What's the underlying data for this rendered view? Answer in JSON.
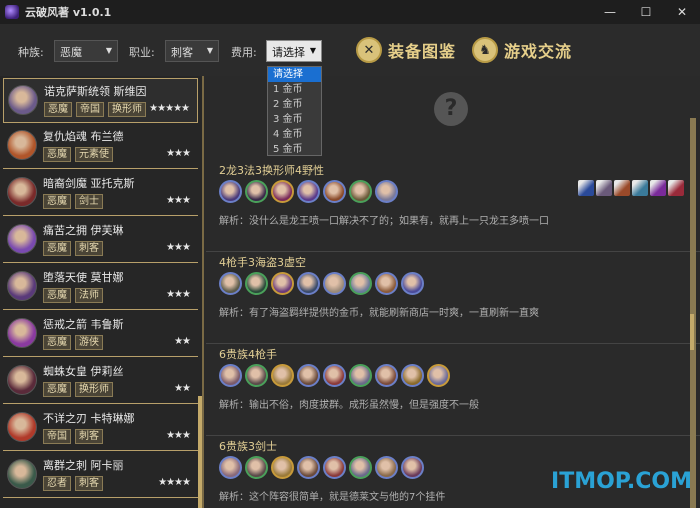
{
  "window": {
    "title": "云破风著 v1.0.1",
    "controls": {
      "minimize": "—",
      "maximize": "☐",
      "close": "✕"
    }
  },
  "toolbar": {
    "race_label": "种族:",
    "race_value": "恶魔",
    "class_label": "职业:",
    "class_value": "刺客",
    "cost_label": "费用:",
    "cost_value": "请选择",
    "equip_button": "装备图鉴",
    "community_button": "游戏交流"
  },
  "cost_dropdown": {
    "options": [
      "请选择",
      "1 金币",
      "2 金币",
      "3 金币",
      "4 金币",
      "5 金币"
    ],
    "selected": 0
  },
  "heroes": [
    {
      "name": "诺克萨斯统领 斯维因",
      "tags": [
        "恶魔",
        "帝国",
        "换形师"
      ],
      "stars": "★★★★★",
      "color": "#6b5a8a"
    },
    {
      "name": "复仇焰魂 布兰德",
      "tags": [
        "恶魔",
        "元素使"
      ],
      "stars": "★★★",
      "color": "#b0552a"
    },
    {
      "name": "暗裔剑魔 亚托克斯",
      "tags": [
        "恶魔",
        "剑士"
      ],
      "stars": "★★★",
      "color": "#7a2a2a"
    },
    {
      "name": "痛苦之拥 伊芙琳",
      "tags": [
        "恶魔",
        "刺客"
      ],
      "stars": "★★★",
      "color": "#7a4ab0"
    },
    {
      "name": "堕落天使 莫甘娜",
      "tags": [
        "恶魔",
        "法师"
      ],
      "stars": "★★★",
      "color": "#5a3a7a"
    },
    {
      "name": "惩戒之箭 韦鲁斯",
      "tags": [
        "恶魔",
        "游侠"
      ],
      "stars": "★★",
      "color": "#8a3aa0"
    },
    {
      "name": "蜘蛛女皇 伊莉丝",
      "tags": [
        "恶魔",
        "换形师"
      ],
      "stars": "★★",
      "color": "#5a2a3a"
    },
    {
      "name": "不详之刃 卡特琳娜",
      "tags": [
        "帝国",
        "刺客"
      ],
      "stars": "★★★",
      "color": "#b03a2a"
    },
    {
      "name": "离群之刺 阿卡丽",
      "tags": [
        "忍者",
        "刺客"
      ],
      "stars": "★★★★",
      "color": "#3a5a4a"
    }
  ],
  "comps": [
    {
      "title": "2龙3法3换形师4野性",
      "desc": "解析：没什么是龙王喷一口解决不了的；如果有，就再上一只龙王多喷一口",
      "icons": [
        "#4a3a7a",
        "#3a2a4a",
        "#7a2a5a",
        "#5a3a8a",
        "#8a4a2a",
        "#6a5a3a",
        "#7a7a9a"
      ],
      "synergies": [
        "#2a4a9a",
        "#6a5a7a",
        "#9a4a2a",
        "#3a7a9a",
        "#7a2a9a",
        "#9a2a3a"
      ]
    },
    {
      "title": "4枪手3海盗3虚空",
      "desc": "解析：有了海盗羁绊提供的金币，就能刷新商店一时爽，一直刷新一直爽",
      "icons": [
        "#5a5a4a",
        "#2a4a3a",
        "#6a3a7a",
        "#3a4a6a",
        "#9a8a7a",
        "#6a7a9a",
        "#8a5a3a",
        "#4a4a9a"
      ],
      "synergies": []
    },
    {
      "title": "6贵族4枪手",
      "desc": "解析：输出不俗，肉度拔群。成形虽然慢，但是强度不一般",
      "icons": [
        "#7a5a6a",
        "#5a4a4a",
        "#9a7a3a",
        "#6a4a3a",
        "#8a3a3a",
        "#6a6a8a",
        "#7a4a3a",
        "#8a6a2a",
        "#6a6a9a"
      ],
      "synergies": []
    },
    {
      "title": "6贵族3剑士",
      "desc": "解析：这个阵容很简单，就是德莱文与他的7个挂件",
      "icons": [
        "#8a6a7a",
        "#5a4a4a",
        "#9a7a3a",
        "#6a4a3a",
        "#8a3a3a",
        "#6a6a8a",
        "#8a6a4a",
        "#6a3a5a"
      ],
      "synergies": []
    }
  ],
  "watermark": "ITMOP.COM"
}
